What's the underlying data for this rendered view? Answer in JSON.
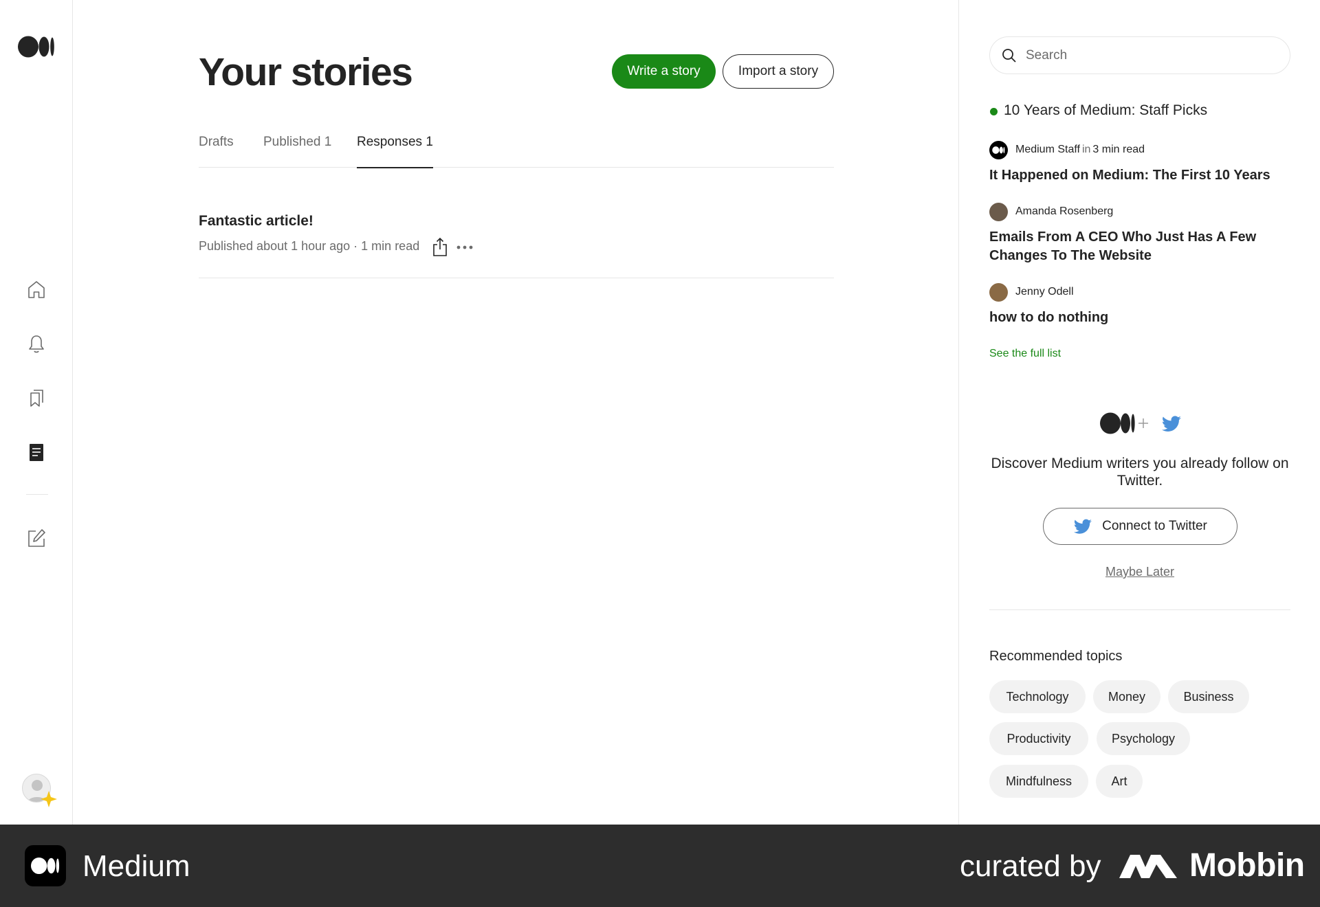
{
  "nav": {
    "logo": "medium-logo",
    "icons": [
      "home-icon",
      "bell-icon",
      "bookmarks-icon",
      "stories-icon",
      "write-icon"
    ]
  },
  "main": {
    "title": "Your stories",
    "write_button": "Write a story",
    "import_button": "Import a story",
    "tabs": [
      {
        "label": "Drafts",
        "active": false
      },
      {
        "label": "Published 1",
        "active": false
      },
      {
        "label": "Responses 1",
        "active": true
      }
    ],
    "story": {
      "title": "Fantastic article!",
      "meta": "Published about 1 hour ago · 1 min read"
    }
  },
  "sidebar": {
    "search_placeholder": "Search",
    "staff_picks_title": "10 Years of Medium: Staff Picks",
    "picks": [
      {
        "author": "Medium Staff",
        "in_text": "in",
        "publication": "3 min read",
        "title": "It Happened on Medium: The First 10 Years"
      },
      {
        "author": "Amanda Rosenberg",
        "title": "Emails From A CEO Who Just Has A Few Changes To The Website"
      },
      {
        "author": "Jenny Odell",
        "title": "how to do nothing"
      }
    ],
    "see_full_list": "See the full list",
    "twitter_prompt": "Discover Medium writers you already follow on Twitter.",
    "connect_twitter": "Connect to Twitter",
    "maybe_later": "Maybe Later",
    "recommended_title": "Recommended topics",
    "topics": [
      "Technology",
      "Money",
      "Business",
      "Productivity",
      "Psychology",
      "Mindfulness",
      "Art"
    ]
  },
  "footer": {
    "app_name": "Medium",
    "curated_by": "curated by",
    "brand": "Mobbin"
  },
  "colors": {
    "accent_green": "#1a8917",
    "twitter_blue": "#4a90d9",
    "footer_bg": "#2d2d2d",
    "star_yellow": "#f5c518"
  }
}
